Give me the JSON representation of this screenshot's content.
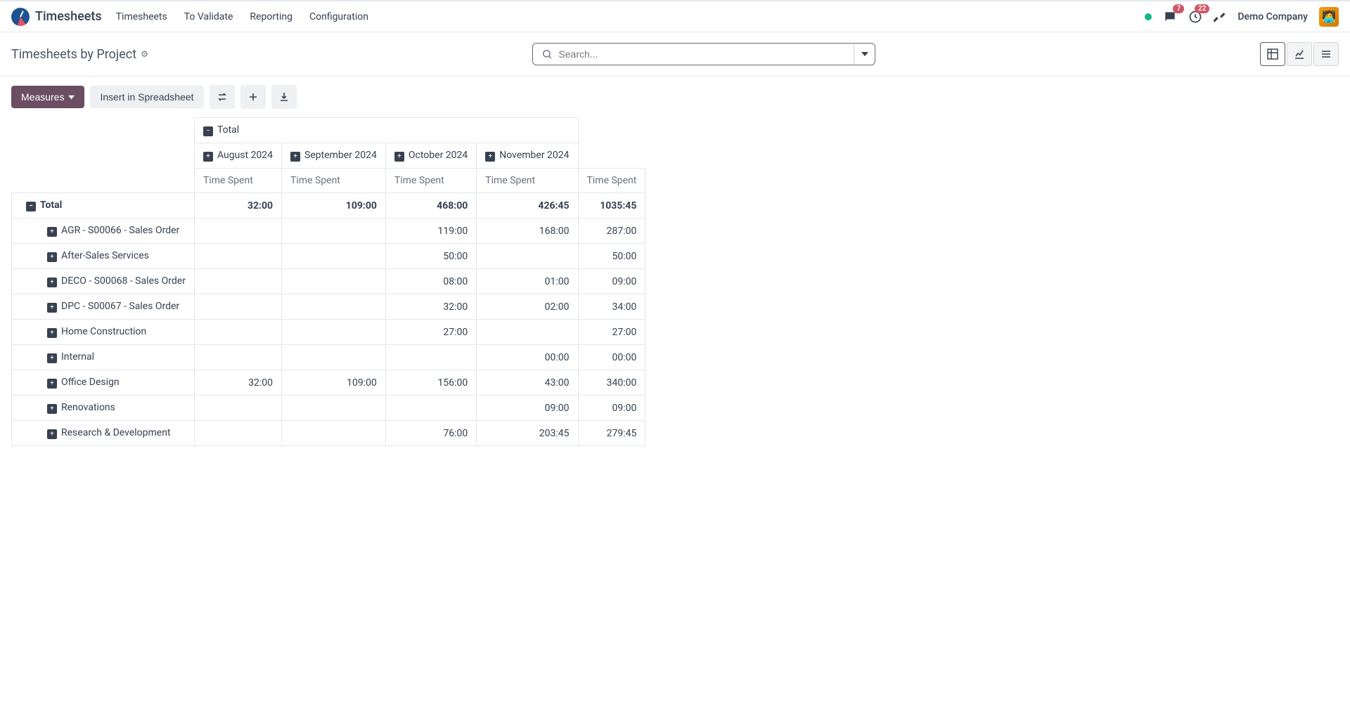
{
  "brand": {
    "title": "Timesheets"
  },
  "nav": {
    "links": [
      "Timesheets",
      "To Validate",
      "Reporting",
      "Configuration"
    ]
  },
  "header_right": {
    "messages_badge": "7",
    "activities_badge": "22",
    "company": "Demo Company"
  },
  "page": {
    "title": "Timesheets by Project"
  },
  "search": {
    "placeholder": "Search..."
  },
  "toolbar": {
    "measures": "Measures",
    "insert": "Insert in Spreadsheet"
  },
  "pivot": {
    "total_label": "Total",
    "months": [
      "August 2024",
      "September 2024",
      "October 2024",
      "November 2024"
    ],
    "measure": "Time Spent",
    "grand_total_row": {
      "label": "Total",
      "values": [
        "32:00",
        "109:00",
        "468:00",
        "426:45",
        "1035:45"
      ]
    },
    "rows": [
      {
        "label": "AGR - S00066 - Sales Order",
        "values": [
          "",
          "",
          "119:00",
          "168:00",
          "287:00"
        ]
      },
      {
        "label": "After-Sales Services",
        "values": [
          "",
          "",
          "50:00",
          "",
          "50:00"
        ]
      },
      {
        "label": "DECO - S00068 - Sales Order",
        "values": [
          "",
          "",
          "08:00",
          "01:00",
          "09:00"
        ]
      },
      {
        "label": "DPC - S00067 - Sales Order",
        "values": [
          "",
          "",
          "32:00",
          "02:00",
          "34:00"
        ]
      },
      {
        "label": "Home Construction",
        "values": [
          "",
          "",
          "27:00",
          "",
          "27:00"
        ]
      },
      {
        "label": "Internal",
        "values": [
          "",
          "",
          "",
          "00:00",
          "00:00"
        ]
      },
      {
        "label": "Office Design",
        "values": [
          "32:00",
          "109:00",
          "156:00",
          "43:00",
          "340:00"
        ]
      },
      {
        "label": "Renovations",
        "values": [
          "",
          "",
          "",
          "09:00",
          "09:00"
        ]
      },
      {
        "label": "Research & Development",
        "values": [
          "",
          "",
          "76:00",
          "203:45",
          "279:45"
        ]
      }
    ]
  }
}
